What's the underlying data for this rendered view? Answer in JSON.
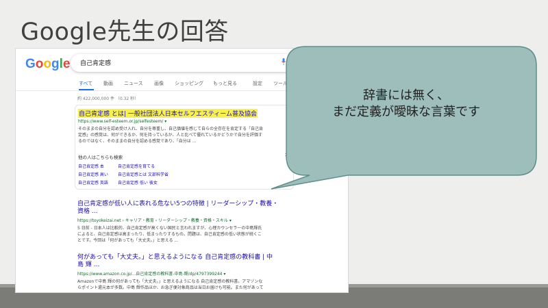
{
  "slide": {
    "title": "Google先生の回答"
  },
  "google": {
    "logo_letters": [
      "G",
      "o",
      "o",
      "g",
      "l",
      "e"
    ],
    "logo_colors": [
      "#4285f4",
      "#ea4335",
      "#fbbc05",
      "#4285f4",
      "#34a853",
      "#ea4335"
    ],
    "query": "自己肯定感",
    "tabs": [
      "すべて",
      "動画",
      "ニュース",
      "画像",
      "ショッピング",
      "もっと見る",
      "設定",
      "ツール"
    ],
    "result_count": "約 422,000,000 件 （0.32 秒）"
  },
  "featured": {
    "title": "自己肯定感 とは| 一般社団法人日本セルフエスティーム普及協会",
    "url": "https://www.self-esteem.or.jp/selfesteem/ ▾",
    "snippet": [
      "そのままの自分を認め受け入れ、自分を尊重し、自己価値を感じて自らの全存在を肯定する「自己肯",
      "定感」の感覚は、何ができるか、何を持っているか、人と比べて優れているかどうかで自分を評価す",
      "るのではなく、そのままの自分を認める感覚であり、「自分は ..."
    ],
    "also_heading": "他の人はこちらも検索",
    "also_links": [
      [
        "自己肯定感 本",
        "自己肯定感を育てる"
      ],
      [
        "自己肯定感 高い",
        "自己肯定感とは 文部科学省"
      ],
      [
        "自己肯定感 英語",
        "自己肯定感 低い 彼女"
      ]
    ]
  },
  "results": [
    {
      "title_lines": [
        "自己肯定感が低い人に表れる危ない5つの特徴 | リーダーシップ・教養・",
        "資格 ..."
      ],
      "url": "https://toyokeizai.net › キャリア・教育 › リーダーシップ・教養・資格・スキル ▾",
      "snippet": [
        "5 日前 - 日本人は比較的、自己肯定感が高くない国民と言われますが、心理カウンセラーの中島輝氏",
        "によると、自己肯定感は高まったり、低まったりするもの。問題は、自己肯定感の低い状態が続くこ",
        "とです。今回は「何があっても「大丈夫。」と思える ..."
      ]
    },
    {
      "title_lines": [
        "何があっても「大丈夫。」と思えるようになる 自己肯定感の教科書 | 中",
        "島 輝 ..."
      ],
      "url": "https://www.amazon.co.jp/...自己肯定感の教科書-中島-輝/dp/4797399244 ▾",
      "snippet": [
        "Amazonで中島 輝の何があっても「大丈夫。」と思えるようになる 自己肯定感の教科書。アマゾンな",
        "らポイント還元本が多数。中島 輝作品ほか、お急ぎ便対象商品は当日お届けも可能。また何があって"
      ]
    }
  ],
  "callout": {
    "lines": [
      "辞書には無く、",
      "まだ定義が曖昧な言葉です"
    ]
  },
  "colors": {
    "callout_fill": "#9dbebb",
    "callout_stroke": "#5f8f8b",
    "link": "#1a0dab",
    "highlight": "#f7f14a"
  }
}
